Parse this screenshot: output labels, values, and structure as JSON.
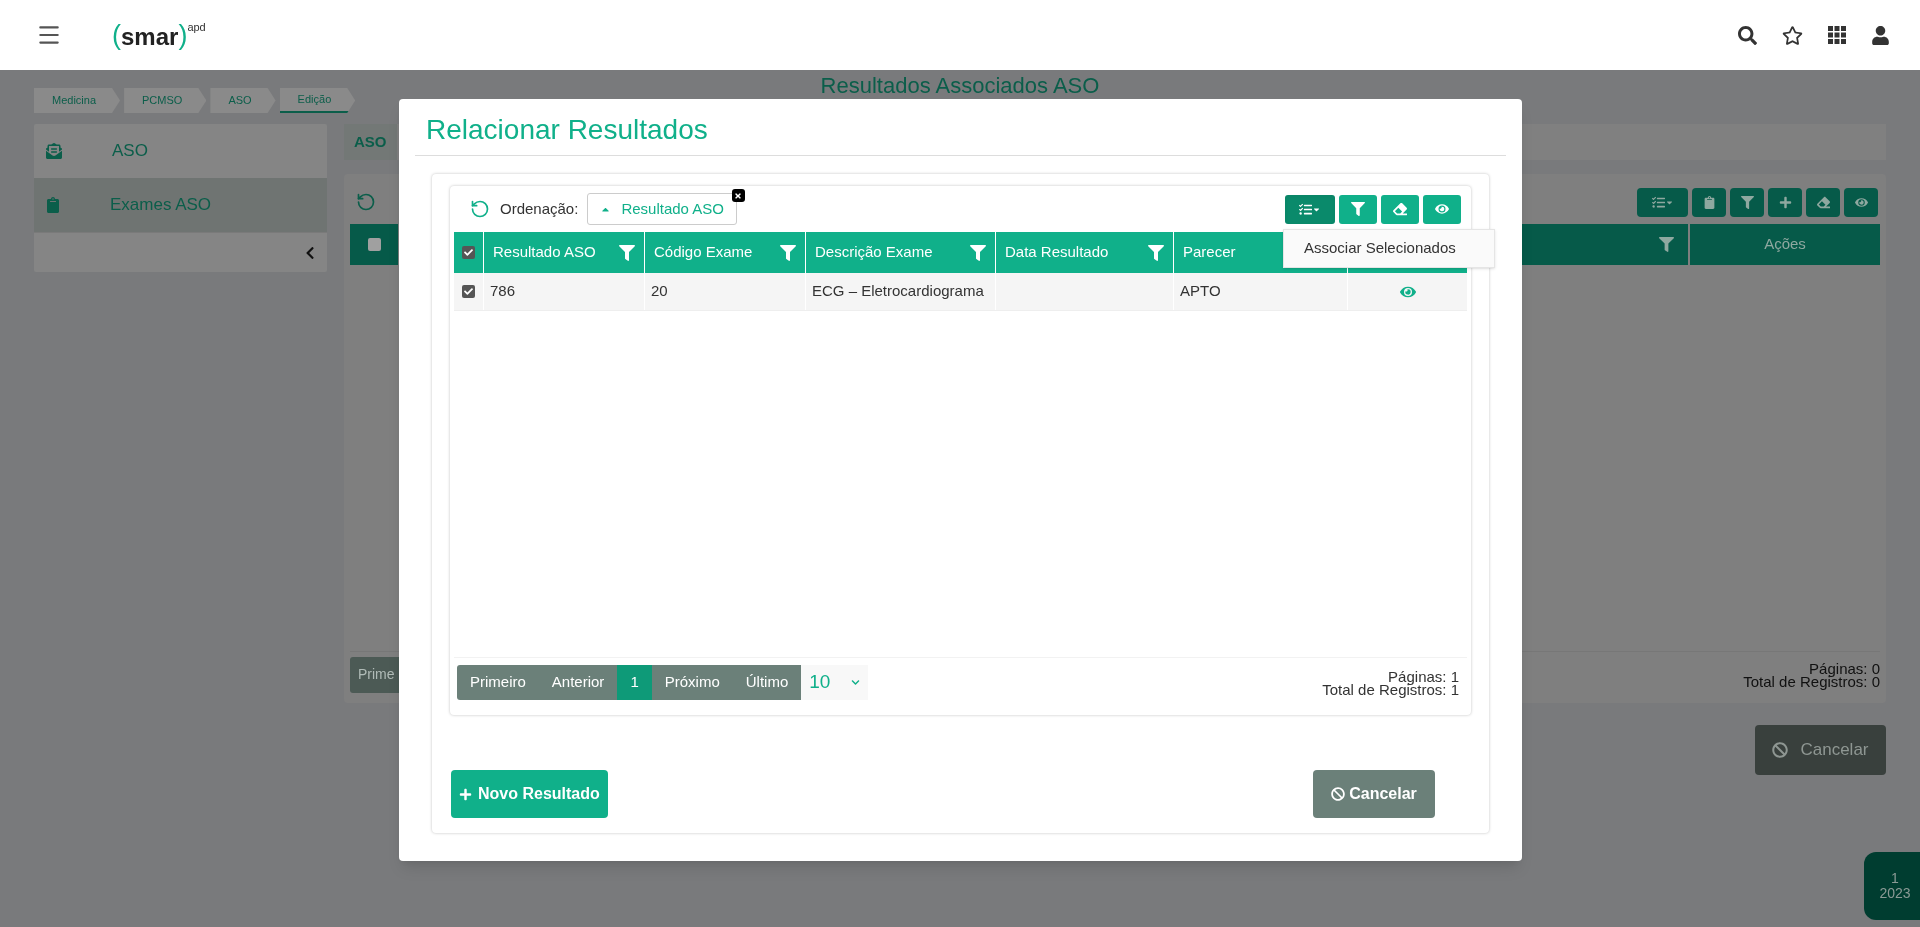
{
  "header": {
    "logo": {
      "open": "(",
      "name": "smar",
      "close": ")",
      "suffix": "apd"
    }
  },
  "breadcrumbs": [
    {
      "label": "Medicina",
      "selected": false
    },
    {
      "label": "PCMSO",
      "selected": false
    },
    {
      "label": "ASO",
      "selected": false
    },
    {
      "label": "Edição",
      "selected": true
    }
  ],
  "page_title": "Resultados Associados ASO",
  "sidebar": {
    "items": [
      {
        "label": "ASO",
        "selected": false
      },
      {
        "label": "Exames ASO",
        "selected": true
      }
    ]
  },
  "background": {
    "tab": "ASO",
    "header_checked": false,
    "last_column": "Ações",
    "first_page_button": "Prime",
    "pages_text": "Páginas: 0",
    "total_text": "Total de Registros: 0",
    "cancel": "Cancelar"
  },
  "year_badge": {
    "month": "1",
    "year": "2023"
  },
  "modal": {
    "title": "Relacionar Resultados",
    "sort": {
      "label": "Ordenação:",
      "chip": "Resultado ASO"
    },
    "menu_open": true,
    "menu": {
      "items": [
        "Associar Selecionados"
      ]
    },
    "table": {
      "all_selected": true,
      "columns": [
        {
          "label": "Resultado ASO",
          "filter": true
        },
        {
          "label": "Código Exame",
          "filter": true
        },
        {
          "label": "Descrição Exame",
          "filter": true
        },
        {
          "label": "Data Resultado",
          "filter": true
        },
        {
          "label": "Parecer",
          "filter": false
        }
      ],
      "rows": [
        {
          "selected": true,
          "cells": [
            "786",
            "20",
            "ECG – Eletrocardiograma",
            "",
            "APTO"
          ]
        }
      ]
    },
    "pagination": {
      "buttons": [
        {
          "label": "Primeiro",
          "selected": false
        },
        {
          "label": "Anterior",
          "selected": false
        },
        {
          "label": "1",
          "selected": true
        },
        {
          "label": "Próximo",
          "selected": false
        },
        {
          "label": "Último",
          "selected": false
        }
      ],
      "page_size": "10",
      "pages_text": "Páginas: 1",
      "total_text": "Total de Registros: 1"
    },
    "new_button": "Novo Resultado",
    "cancel_button": "Cancelar"
  }
}
